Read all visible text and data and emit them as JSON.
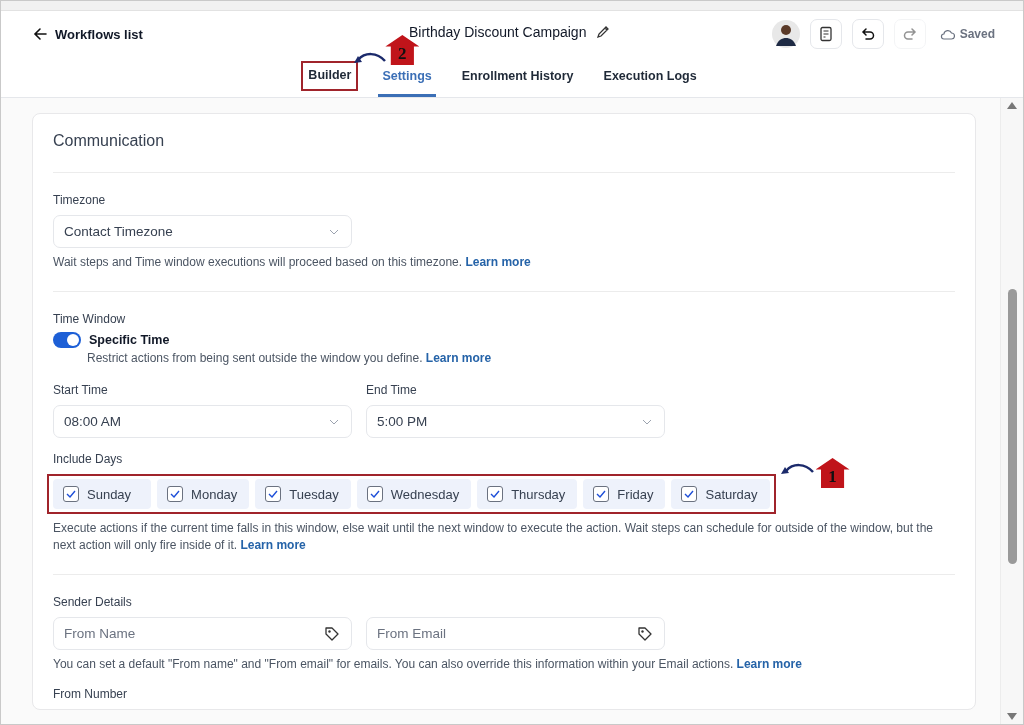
{
  "header": {
    "back_label": "Workflows list",
    "title": "Birthday Discount Campaign",
    "status": "Saved",
    "redo_disabled": true
  },
  "tabs": [
    {
      "label": "Builder",
      "selected": false,
      "annotation_marker": "2"
    },
    {
      "label": "Settings",
      "selected": true
    },
    {
      "label": "Enrollment History",
      "selected": false
    },
    {
      "label": "Execution Logs",
      "selected": false
    }
  ],
  "section_title": "Communication",
  "timezone": {
    "label": "Timezone",
    "value": "Contact Timezone",
    "help": "Wait steps and Time window executions will proceed based on this timezone.",
    "link": "Learn more"
  },
  "time_window": {
    "label": "Time Window",
    "toggle_label": "Specific Time",
    "on": true,
    "help": "Restrict actions from being sent outside the window you define.",
    "link": "Learn more"
  },
  "start_time": {
    "label": "Start Time",
    "value": "08:00 AM"
  },
  "end_time": {
    "label": "End Time",
    "value": "5:00 PM"
  },
  "include_days": {
    "label": "Include Days",
    "annotation_marker": "1",
    "days": [
      {
        "label": "Sunday",
        "checked": true
      },
      {
        "label": "Monday",
        "checked": true
      },
      {
        "label": "Tuesday",
        "checked": true
      },
      {
        "label": "Wednesday",
        "checked": true
      },
      {
        "label": "Thursday",
        "checked": true
      },
      {
        "label": "Friday",
        "checked": true
      },
      {
        "label": "Saturday",
        "checked": true
      }
    ],
    "help": "Execute actions if the current time falls in this window, else wait until the next window to execute the action. Wait steps can schedule for outside of the window, but the next action will only fire inside of it.",
    "link": "Learn more"
  },
  "sender_details": {
    "label": "Sender Details",
    "fields": [
      {
        "placeholder": "From Name"
      },
      {
        "placeholder": "From Email"
      }
    ],
    "help": "You can set a default \"From name\" and \"From email\" for emails. You can also override this information within your Email actions.",
    "link": "Learn more"
  },
  "from_number": {
    "label": "From Number"
  }
}
